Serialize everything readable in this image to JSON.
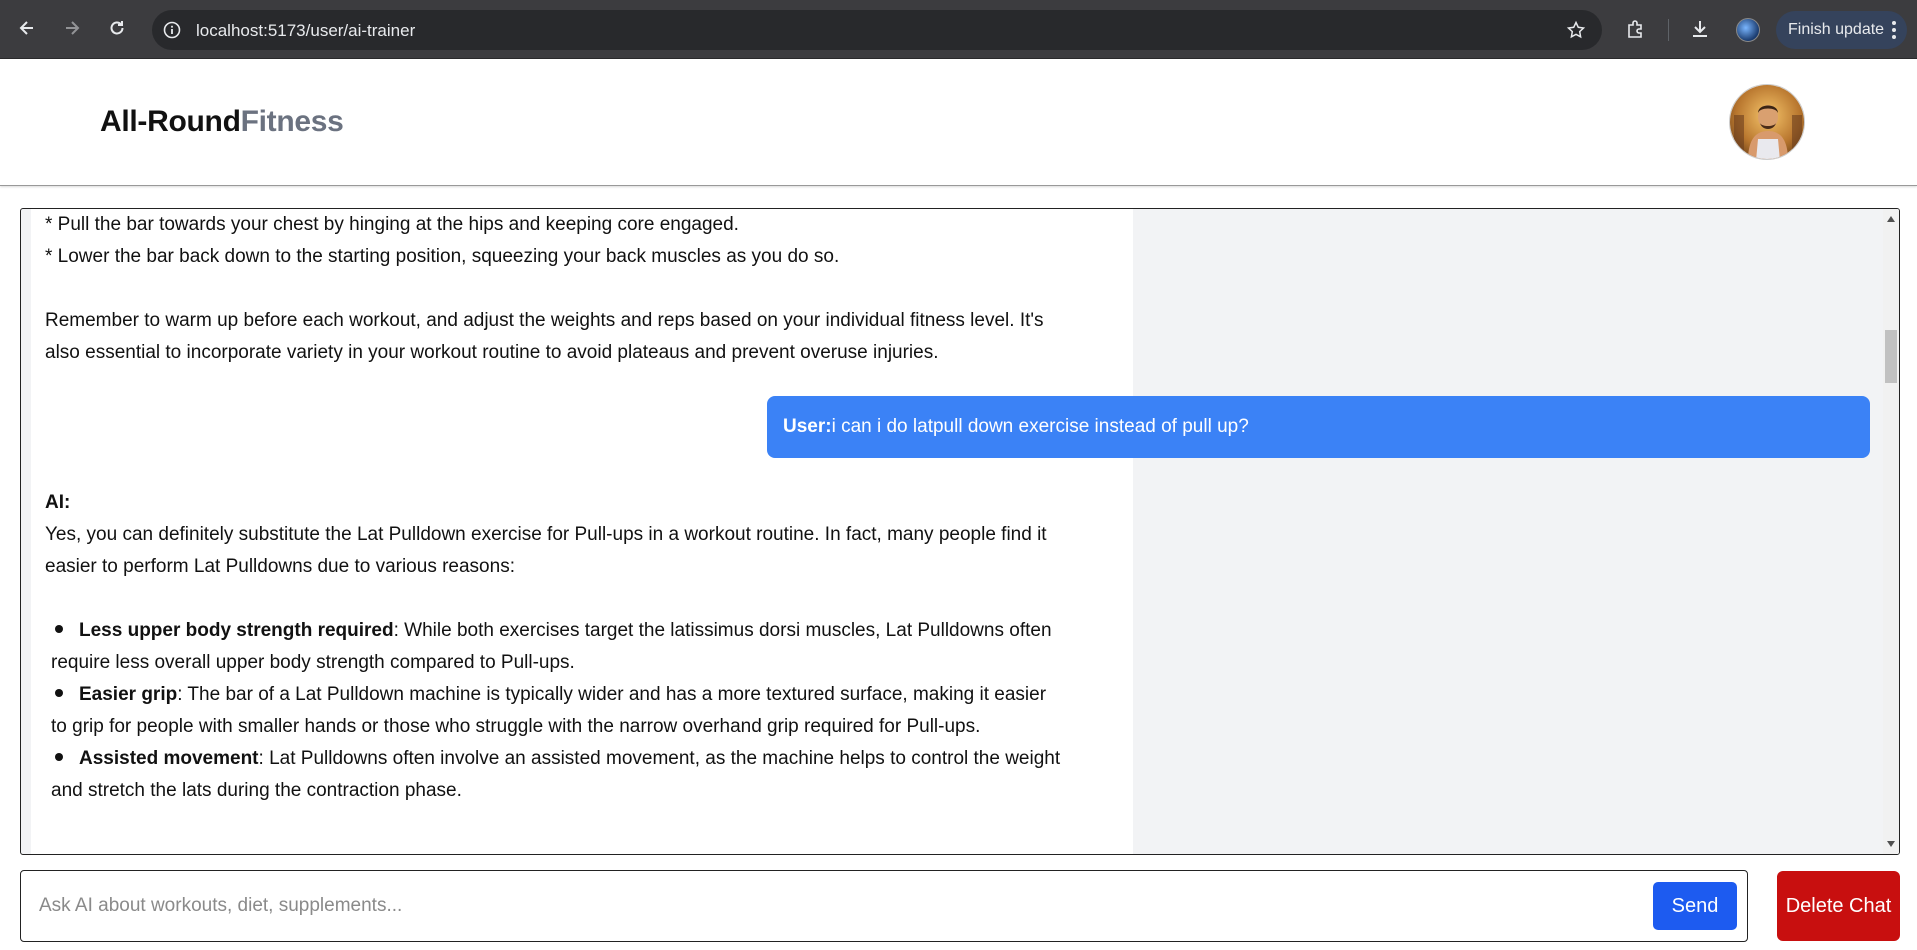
{
  "browser": {
    "url": "localhost:5173/user/ai-trainer",
    "finish_update_label": "Finish update"
  },
  "header": {
    "logo_part1": "All-Round",
    "logo_part2": "Fitness"
  },
  "chat": {
    "ai_message_1": {
      "lines": [
        "* Pull the bar towards your chest by hinging at the hips and keeping core engaged.",
        "* Lower the bar back down to the starting position, squeezing your back muscles as you do so.",
        "Remember to warm up before each workout, and adjust the weights and reps based on your individual fitness level. It's",
        "also essential to incorporate variety in your workout routine to avoid plateaus and prevent overuse injuries."
      ]
    },
    "user_message": {
      "prefix": "User:",
      "text": "i can i do latpull down exercise instead of pull up?"
    },
    "ai_message_2": {
      "prefix": "AI:",
      "intro_lines": [
        "Yes, you can definitely substitute the Lat Pulldown exercise for Pull-ups in a workout routine. In fact, many people find it",
        "easier to perform Lat Pulldowns due to various reasons:"
      ],
      "bullets": [
        {
          "title": "Less upper body strength required",
          "line1": ": While both exercises target the latissimus dorsi muscles, Lat Pulldowns often",
          "line2": "require less overall upper body strength compared to Pull-ups."
        },
        {
          "title": "Easier grip",
          "line1": ": The bar of a Lat Pulldown machine is typically wider and has a more textured surface, making it easier",
          "line2": "to grip for people with smaller hands or those who struggle with the narrow overhand grip required for Pull-ups."
        },
        {
          "title": "Assisted movement",
          "line1": ": Lat Pulldowns often involve an assisted movement, as the machine helps to control the weight",
          "line2": "and stretch the lats during the contraction phase."
        }
      ]
    }
  },
  "input": {
    "placeholder": "Ask AI about workouts, diet, supplements...",
    "value": ""
  },
  "buttons": {
    "send_label": "Send",
    "delete_label": "Delete Chat"
  },
  "colors": {
    "user_bubble": "#3b82f6",
    "send_button": "#1d5bf0",
    "delete_button": "#c80f0f",
    "chat_background": "#f2f3f5"
  }
}
